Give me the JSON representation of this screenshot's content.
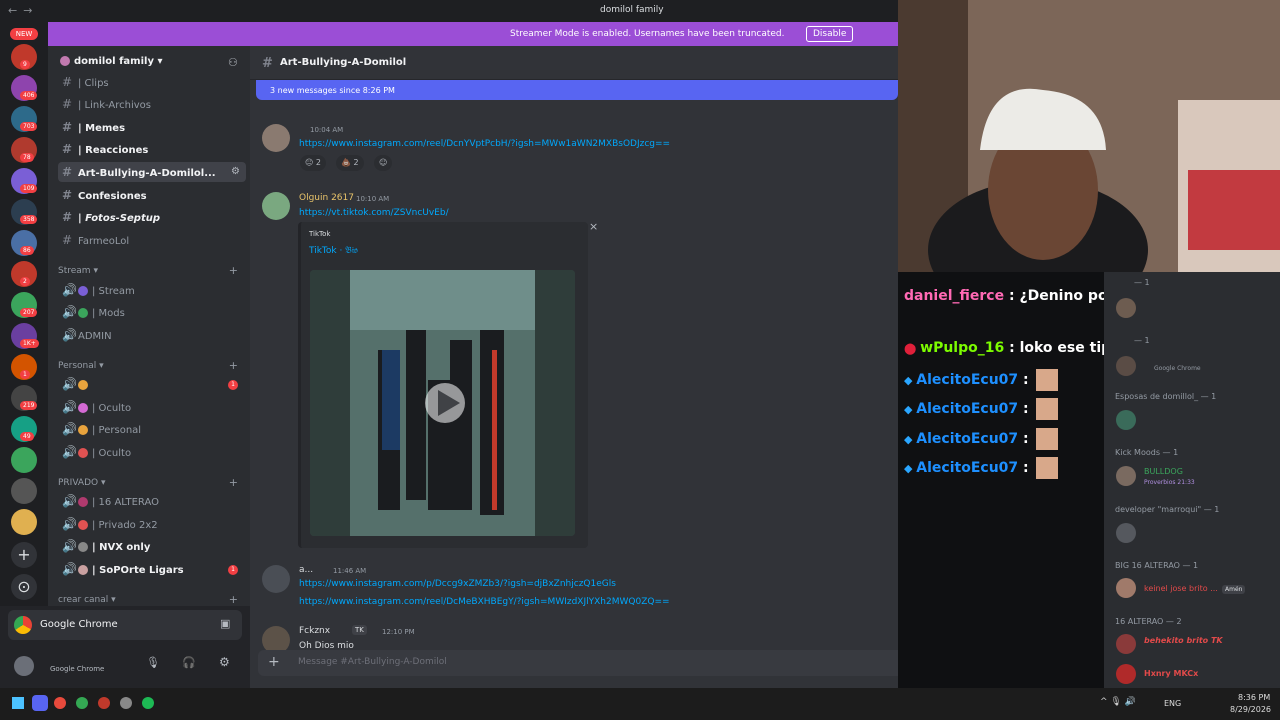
{
  "window": {
    "title": "domilol family"
  },
  "banner": {
    "text": "Streamer Mode is enabled. Usernames have been truncated.",
    "disable_label": "Disable"
  },
  "rail": {
    "new_label": "NEW",
    "badges": [
      "9",
      "406",
      "703",
      "78",
      "109",
      "358",
      "86",
      "2",
      "207",
      "1K+",
      "1",
      "219",
      "49"
    ]
  },
  "sidebar": {
    "guild_name": "domilol family",
    "channels": [
      "| Clips",
      "| Link-Archivos",
      "| Memes",
      "| Reacciones",
      "Art-Bullying-A-Domilol...",
      "Confesiones",
      "| Fotos-Septup",
      "FarmeoLol"
    ],
    "stream_category": "Stream",
    "stream_channels": [
      "| Stream",
      "| Mods",
      "ADMIN"
    ],
    "personal_category": "Personal",
    "personal_channels": [
      "",
      "| Oculto",
      "| Personal",
      "| Oculto"
    ],
    "personal_badge": "1",
    "privado_category": "PRIVADO",
    "privado_channels": [
      "| 16 ALTERAO",
      "| Privado 2x2",
      "| NVX only",
      "| SoPOrte Ligars"
    ],
    "privado_badge": "1",
    "crear_canal": "crear canal"
  },
  "user_panel": {
    "activity": "Google Chrome",
    "status": "Google Chrome"
  },
  "chat": {
    "channel_name": "Art-Bullying-A-Domilol",
    "new_messages": "3 new messages since 8:26 PM",
    "messages": [
      {
        "time": "10:04 AM",
        "link": "https://www.instagram.com/reel/DcnYVptPcbH/?igsh=MWw1aWN2MXBsODJzcg==",
        "reactions": [
          "2",
          "2"
        ]
      },
      {
        "author": "Olguin 2617",
        "time": "10:10 AM",
        "link": "https://vt.tiktok.com/ZSVncUvEb/",
        "embed_provider": "TikTok",
        "embed_title": "TikTok · 𝔅𝔦𝔬"
      },
      {
        "author": "a...",
        "time": "11:46 AM",
        "links": [
          "https://www.instagram.com/p/Dccg9xZMZb3/?igsh=djBxZnhjczQ1eGls",
          "https://www.instagram.com/reel/DcMeBXHBEgY/?igsh=MWIzdXJlYXh2MWQ0ZQ=="
        ]
      },
      {
        "author": "Fckznx",
        "tag": "TK",
        "time": "12:10 PM",
        "preview": "Oh Dios mio"
      }
    ],
    "composer_placeholder": "Message #Art-Bullying-A-Domilol"
  },
  "stream_chat": [
    {
      "user": "daniel_fierce",
      "text": "¿Denino por odiar su propia gente? cu",
      "color": "#ff69b4"
    },
    {
      "user": "wPulpo_16",
      "text": "loko ese tipo es un fracasado",
      "color": "#7cfc00"
    },
    {
      "user": "AlecitoEcu07",
      "text": ":",
      "color": "#1e90ff"
    },
    {
      "user": "AlecitoEcu07",
      "text": ":",
      "color": "#1e90ff"
    },
    {
      "user": "AlecitoEcu07",
      "text": ":",
      "color": "#1e90ff"
    },
    {
      "user": "AlecitoEcu07",
      "text": ":",
      "color": "#1e90ff"
    }
  ],
  "members": {
    "top_counts": [
      "— 1",
      "— 1"
    ],
    "chrome_status": "Google Chrome",
    "esposas": "Esposas de domillol_ — 1",
    "kick_mods": "Kick Moods — 1",
    "bulldog": "BULLDOG",
    "bulldog_sub": "Proverbios 21:33",
    "developer": "developer \"marroqui\" — 1",
    "big16": "BIG 16 ALTERAO — 1",
    "keinel": "keinel jose brito ...",
    "keinel_tag": "Amén",
    "alterao16": "16 ALTERAO — 2",
    "behekito": "behekito brito TK",
    "hxnry": "Hxnry MKCx"
  },
  "taskbar": {
    "lang": "ENG",
    "time": "8:36 PM",
    "date": "8/29/2026"
  }
}
